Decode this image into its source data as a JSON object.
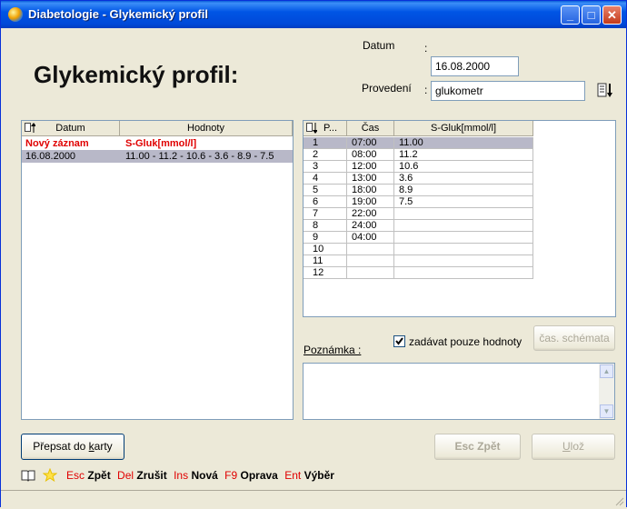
{
  "window": {
    "title": "Diabetologie - Glykemický profil"
  },
  "heading": "Glykemický profil:",
  "datum": {
    "label": "Datum",
    "colon": ":",
    "value": "16.08.2000"
  },
  "provedeni": {
    "label": "Provedení",
    "colon": ":",
    "value": "glukometr"
  },
  "left_list": {
    "headers": [
      "Datum",
      "Hodnoty"
    ],
    "new_row": {
      "datum": "Nový záznam",
      "hodnoty": "S-Gluk[mmol/l]"
    },
    "rows": [
      {
        "datum": "16.08.2000",
        "hodnoty": "11.00 - 11.2 - 10.6 - 3.6 - 8.9 - 7.5"
      }
    ]
  },
  "right_grid": {
    "headers": [
      "P...",
      "Čas",
      "S-Gluk[mmol/l]"
    ],
    "rows": [
      {
        "p": "1",
        "cas": "07:00",
        "val": "11.00"
      },
      {
        "p": "2",
        "cas": "08:00",
        "val": "11.2"
      },
      {
        "p": "3",
        "cas": "12:00",
        "val": "10.6"
      },
      {
        "p": "4",
        "cas": "13:00",
        "val": "3.6"
      },
      {
        "p": "5",
        "cas": "18:00",
        "val": "8.9"
      },
      {
        "p": "6",
        "cas": "19:00",
        "val": "7.5"
      },
      {
        "p": "7",
        "cas": "22:00",
        "val": ""
      },
      {
        "p": "8",
        "cas": "24:00",
        "val": ""
      },
      {
        "p": "9",
        "cas": "04:00",
        "val": ""
      },
      {
        "p": "10",
        "cas": "",
        "val": ""
      },
      {
        "p": "11",
        "cas": "",
        "val": ""
      },
      {
        "p": "12",
        "cas": "",
        "val": ""
      }
    ]
  },
  "checkbox": {
    "label": "zadávat pouze hodnoty",
    "checked": true
  },
  "cas_schemata_label": "čas. schémata",
  "poznamka_label": "Poznámka :",
  "buttons": {
    "prepsat_pre": "Přepsat do ",
    "prepsat_u": "k",
    "prepsat_post": "arty",
    "esc_zpet": "Esc  Zpět",
    "uloz_u": "U",
    "uloz_post": "lož"
  },
  "shortcuts": [
    {
      "key": "Esc",
      "action": "Zpět"
    },
    {
      "key": "Del",
      "action": "Zrušit"
    },
    {
      "key": "Ins",
      "action": "Nová"
    },
    {
      "key": "F9",
      "action": "Oprava"
    },
    {
      "key": "Ent",
      "action": "Výběr"
    }
  ],
  "colors": {
    "title_bar": "#0055e5",
    "highlight_red": "#e00000",
    "selected_row": "#b8b8c8"
  }
}
